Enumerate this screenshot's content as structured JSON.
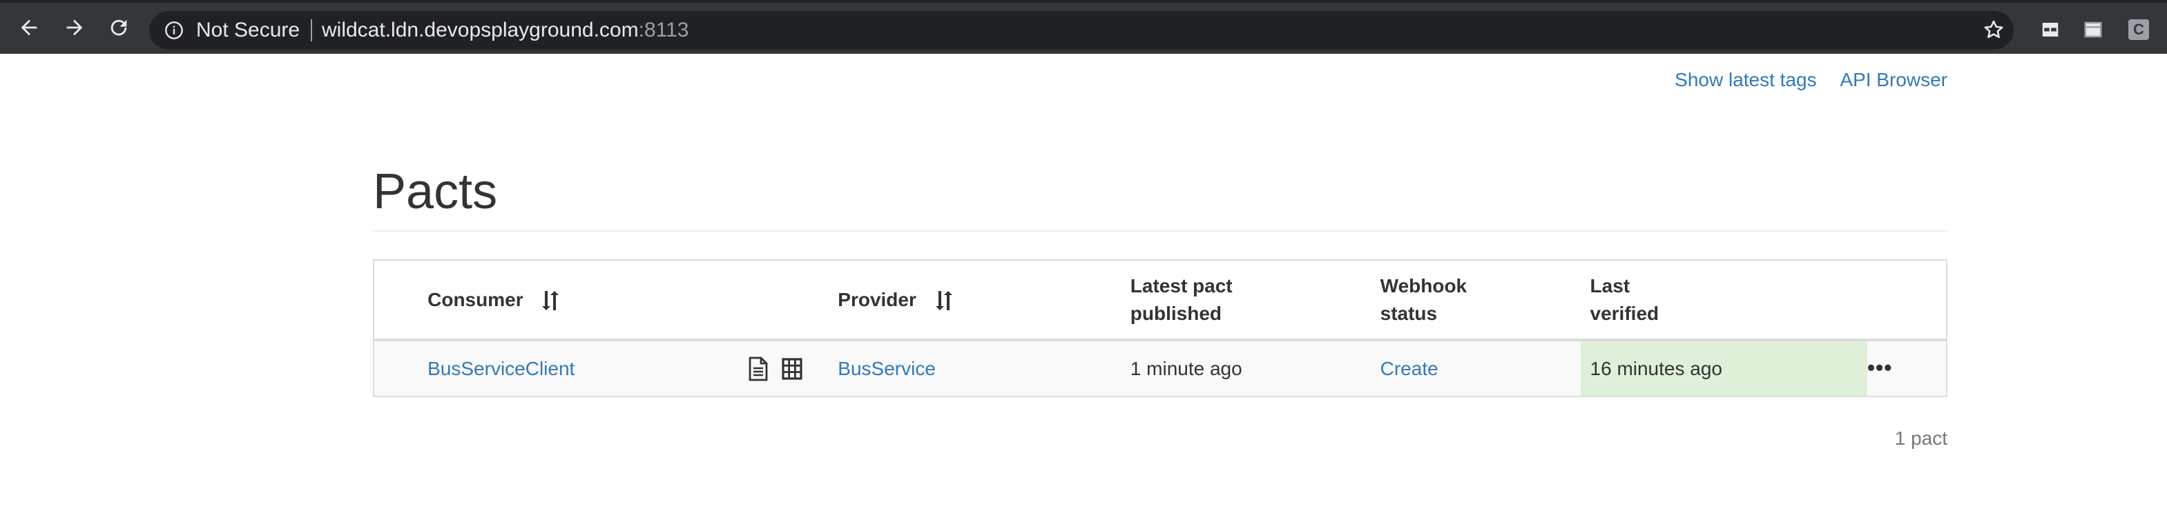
{
  "browser": {
    "security_label": "Not Secure",
    "url_host": "wildcat.ldn.devopsplayground.com",
    "url_port": ":8113",
    "profile_initial": "C"
  },
  "header_links": {
    "show_latest_tags": "Show latest tags",
    "api_browser": "API Browser"
  },
  "page": {
    "title": "Pacts"
  },
  "table": {
    "headers": {
      "consumer": "Consumer",
      "provider": "Provider",
      "latest_pact_line1": "Latest pact",
      "latest_pact_line2": "published",
      "webhook_line1": "Webhook",
      "webhook_line2": "status",
      "last_verified_line1": "Last",
      "last_verified_line2": "verified"
    },
    "rows": [
      {
        "consumer": "BusServiceClient",
        "provider": "BusService",
        "latest_pact_published": "1 minute ago",
        "webhook_status": "Create",
        "last_verified": "16 minutes ago",
        "actions": "•••"
      }
    ]
  },
  "footer": {
    "count": "1 pact"
  },
  "colors": {
    "link": "#337ab7",
    "verified_bg": "#dff0d8",
    "chrome_bg": "#35363a"
  }
}
